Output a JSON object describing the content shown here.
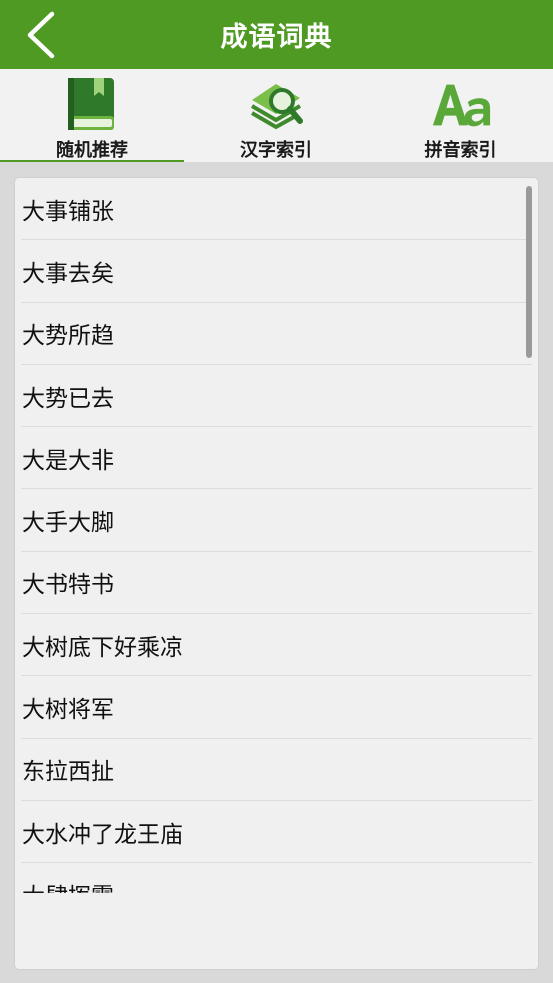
{
  "header": {
    "title": "成语词典"
  },
  "tabs": [
    {
      "label": "随机推荐",
      "icon": "book-icon",
      "selected": true
    },
    {
      "label": "汉字索引",
      "icon": "book-search-icon",
      "selected": false
    },
    {
      "label": "拼音索引",
      "icon": "aa-letters-icon",
      "selected": false
    }
  ],
  "list": {
    "items": [
      "大事铺张",
      "大事去矣",
      "大势所趋",
      "大势已去",
      "大是大非",
      "大手大脚",
      "大书特书",
      "大树底下好乘凉",
      "大树将军",
      "东拉西扯",
      "大水冲了龙王庙",
      "大肆挥霍"
    ]
  },
  "colors": {
    "accent": "#4e9a22",
    "header_text": "#ffffff"
  }
}
